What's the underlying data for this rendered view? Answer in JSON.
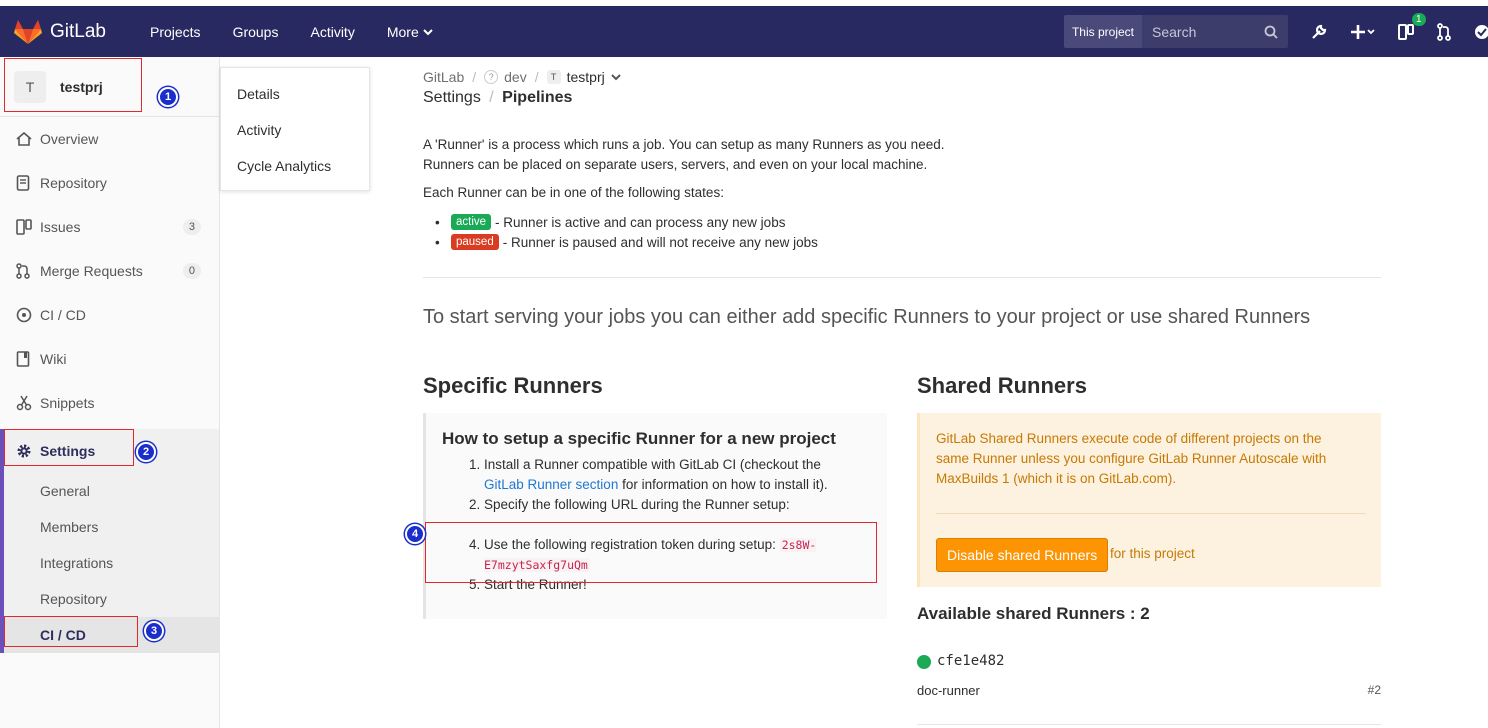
{
  "navbar": {
    "brand": "GitLab",
    "links": [
      "Projects",
      "Groups",
      "Activity",
      "More"
    ],
    "scope": "This project",
    "search_placeholder": "Search",
    "todo_count": "1"
  },
  "sidebar": {
    "avatar_letter": "T",
    "project_name": "testprj",
    "items": [
      {
        "label": "Overview",
        "icon": "home-icon"
      },
      {
        "label": "Repository",
        "icon": "repository-icon"
      },
      {
        "label": "Issues",
        "icon": "issues-icon",
        "count": "3"
      },
      {
        "label": "Merge Requests",
        "icon": "merge-request-icon",
        "count": "0"
      },
      {
        "label": "CI / CD",
        "icon": "rocket-icon"
      },
      {
        "label": "Wiki",
        "icon": "book-icon"
      },
      {
        "label": "Snippets",
        "icon": "scissors-icon"
      }
    ],
    "settings_label": "Settings",
    "settings_sub": [
      "General",
      "Members",
      "Integrations",
      "Repository",
      "CI / CD"
    ]
  },
  "flyout": {
    "items": [
      "Details",
      "Activity",
      "Cycle Analytics"
    ]
  },
  "annotations": [
    "1",
    "2",
    "3",
    "4"
  ],
  "breadcrumb": {
    "root": "GitLab",
    "group": "dev",
    "project_avatar": "T",
    "project": "testprj",
    "section": "Settings",
    "page": "Pipelines"
  },
  "intro": {
    "line1": "A 'Runner' is a process which runs a job. You can setup as many Runners as you need.",
    "line2": "Runners can be placed on separate users, servers, and even on your local machine.",
    "states_intro": "Each Runner can be in one of the following states:",
    "active_badge": "active",
    "active_desc": "- Runner is active and can process any new jobs",
    "paused_badge": "paused",
    "paused_desc": "- Runner is paused and will not receive any new jobs"
  },
  "lead": "To start serving your jobs you can either add specific Runners to your project or use shared Runners",
  "specific": {
    "title": "Specific Runners",
    "box_title": "How to setup a specific Runner for a new project",
    "step1_pre": "Install a Runner compatible with GitLab CI (checkout the",
    "step1_link": "GitLab Runner section",
    "step1_post": "for information on how to install it).",
    "step2": "Specify the following URL during the Runner setup:",
    "step3": "Use the following registration token during setup:",
    "token": "2s8W-E7mzytSaxfg7uQm",
    "step4": "Start the Runner!"
  },
  "shared": {
    "title": "Shared Runners",
    "description": "GitLab Shared Runners execute code of different projects on the same Runner unless you configure GitLab Runner Autoscale with MaxBuilds 1 (which it is on GitLab.com).",
    "disable_button": "Disable shared Runners",
    "for_project": "for this project",
    "available_title": "Available shared Runners : 2",
    "runner": {
      "token": "cfe1e482",
      "description": "doc-runner",
      "id": "#2"
    }
  }
}
